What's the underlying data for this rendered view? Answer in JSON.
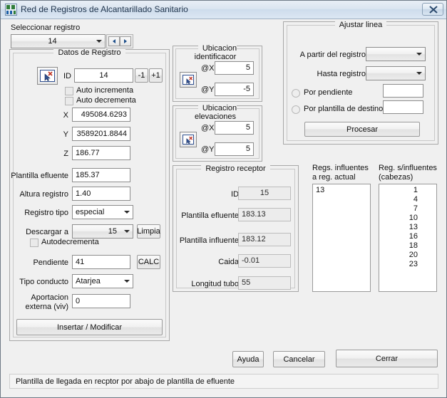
{
  "window": {
    "title": "Red de Registros de Alcantarillado Sanitario",
    "icon": "app-network-icon",
    "close_label": "×"
  },
  "select_record": {
    "label": "Seleccionar registro",
    "value": "14",
    "prev_label": "◄",
    "next_label": "►"
  },
  "datos_registro": {
    "caption": "Datos de Registro",
    "pick_icon": "pick-point-icon",
    "id_label": "ID",
    "id_value": "14",
    "minus_label": "-1",
    "plus_label": "+1",
    "auto_increment_label": "Auto incrementa",
    "auto_decrement_label": "Auto decrementa",
    "x_label": "X",
    "x_value": "495084.6293",
    "y_label": "Y",
    "y_value": "3589201.8844",
    "z_label": "Z",
    "z_value": "186.77",
    "plantilla_efluente_label": "Plantilla efluente",
    "plantilla_efluente_value": "185.37",
    "altura_registro_label": "Altura registro",
    "altura_registro_value": "1.40",
    "registro_tipo_label": "Registro tipo",
    "registro_tipo_value": "especial",
    "descargar_a_label": "Descargar a",
    "descargar_a_value": "15",
    "limpia_label": "Limpia",
    "autodecrementa_label": "Autodecrementa",
    "pendiente_label": "Pendiente",
    "pendiente_value": "41",
    "calc_label": "CALC",
    "tipo_conducto_label": "Tipo conducto",
    "tipo_conducto_value": "Atarjea",
    "aportacion_label_1": "Aportacion",
    "aportacion_label_2": "externa (viv)",
    "aportacion_value": "0",
    "insert_modify_label": "Insertar / Modificar"
  },
  "ubicacion_identificador": {
    "caption": "Ubicacion identificacor",
    "pick_icon": "pick-point-icon",
    "x_label": "@X",
    "x_value": "5",
    "y_label": "@Y",
    "y_value": "-5"
  },
  "ubicacion_elevaciones": {
    "caption": "Ubicacion elevaciones",
    "pick_icon": "pick-point-icon",
    "x_label": "@X",
    "x_value": "5",
    "y_label": "@Y",
    "y_value": "5"
  },
  "registro_receptor": {
    "caption": "Registro receptor",
    "id_label": "ID",
    "id_value": "15",
    "plantilla_efluente_label": "Plantilla efluente",
    "plantilla_efluente_value": "183.13",
    "plantilla_influente_label": "Plantilla influente",
    "plantilla_influente_value": "183.12",
    "caida_label": "Caida",
    "caida_value": "-0.01",
    "longitud_tubo_label": "Longitud tubo",
    "longitud_tubo_value": "55"
  },
  "ajustar_linea": {
    "caption": "Ajustar linea",
    "from_label": "A partir del registro",
    "from_value": "",
    "to_label": "Hasta registro",
    "to_value": "",
    "por_pendiente_label": "Por pendiente",
    "por_pendiente_value": "",
    "por_plantilla_label": "Por plantilla de destino",
    "por_plantilla_value": "",
    "procesar_label": "Procesar"
  },
  "influentes": {
    "title_line1": "Regs. influentes",
    "title_line2": "a reg. actual",
    "items": [
      "13"
    ]
  },
  "cabezas": {
    "title_line1": "Reg. s/influentes",
    "title_line2": "(cabezas)",
    "items": [
      "1",
      "4",
      "7",
      "10",
      "13",
      "16",
      "18",
      "20",
      "23"
    ]
  },
  "footer": {
    "ayuda_label": "Ayuda",
    "cancelar_label": "Cancelar",
    "cerrar_label": "Cerrar",
    "status_text": "Plantilla de llegada  en recptor por abajo de plantilla de efluente"
  },
  "colors": {
    "window_bg": "#f0f0f0",
    "titlebar": "#dbe5f0",
    "accent_blue": "#1c4e8a",
    "icon_red": "#c0392b"
  }
}
